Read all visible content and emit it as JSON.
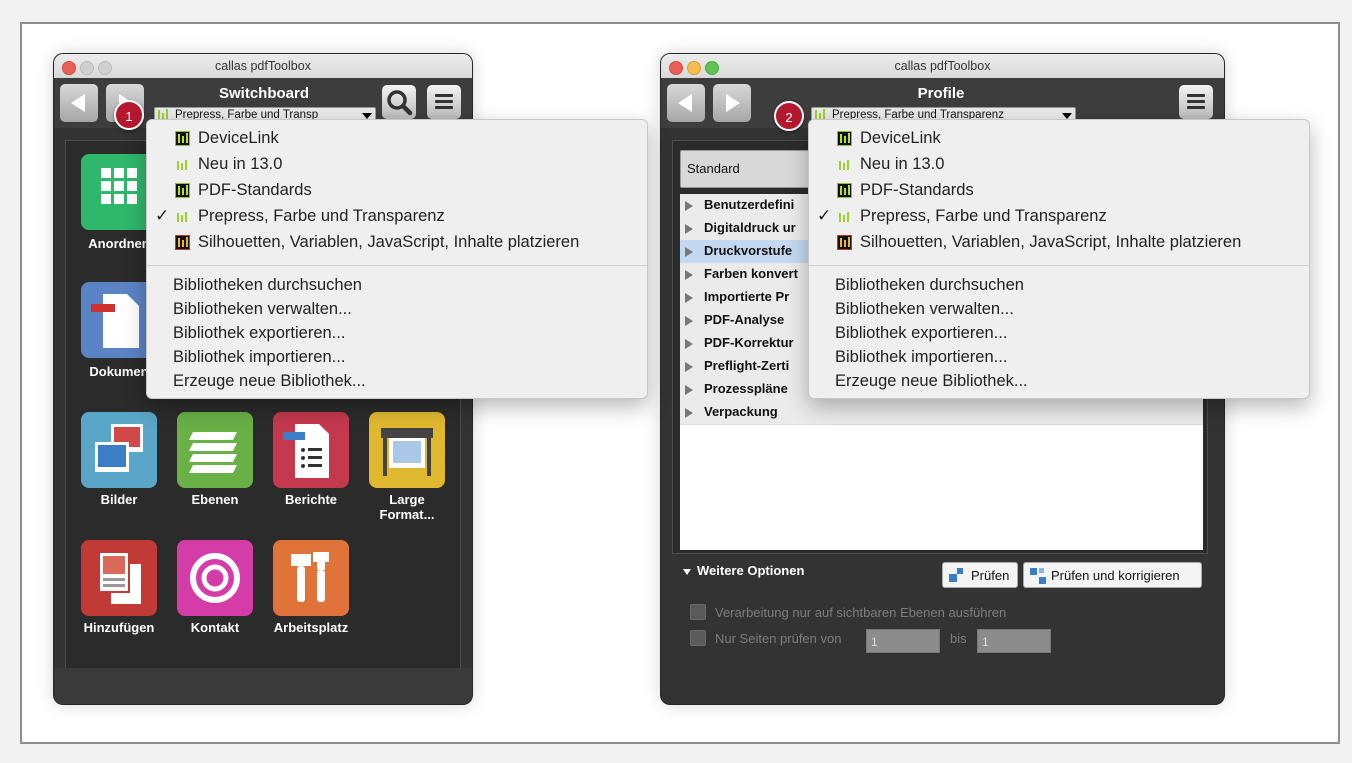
{
  "colors": {
    "badge": "#b5172f",
    "window_bg": "#333333",
    "highlight_row": "#c3d9f1"
  },
  "left_window": {
    "title": "callas pdfToolbox",
    "header_title": "Switchboard",
    "selector_value": "Prepress, Farbe und Transp",
    "badge": "1",
    "apps": [
      {
        "label": "Anordnen",
        "icon": "grid-icon"
      },
      {
        "label": "Dokumen",
        "icon": "document-icon"
      },
      {
        "label": "Bilder",
        "icon": "pictures-icon"
      },
      {
        "label": "Ebenen",
        "icon": "layers-icon"
      },
      {
        "label": "Berichte",
        "icon": "report-icon"
      },
      {
        "label": "Large Format...",
        "icon": "large-format-printer-icon"
      },
      {
        "label": "Hinzufügen",
        "icon": "add-pages-icon"
      },
      {
        "label": "Kontakt",
        "icon": "target-icon"
      },
      {
        "label": "Arbeitsplatz",
        "icon": "tools-icon"
      }
    ]
  },
  "right_window": {
    "title": "callas pdfToolbox",
    "header_title": "Profile",
    "selector_value": "Prepress, Farbe und Transparenz",
    "badge": "2",
    "dropdown_value": "Standard",
    "tree": [
      "Benutzerdefini",
      "Digitaldruck ur",
      "Druckvorstufe",
      "Farben konvert",
      "Importierte Pr",
      "PDF-Analyse",
      "PDF-Korrektur",
      "Preflight-Zerti",
      "Prozesspläne",
      "Verpackung"
    ],
    "more_options": "Weitere Optionen",
    "btn_check": "Prüfen",
    "btn_fix": "Prüfen und korrigieren",
    "opt_visible_layers": "Verarbeitung nur auf sichtbaren Ebenen ausführen",
    "opt_pages_prefix": "Nur Seiten prüfen von",
    "opt_pages_from": "1",
    "opt_pages_to_label": "bis",
    "opt_pages_to": "1"
  },
  "menu": {
    "libraries": [
      {
        "label": "DeviceLink",
        "checked": false
      },
      {
        "label": "Neu in 13.0",
        "checked": false
      },
      {
        "label": "PDF-Standards",
        "checked": false
      },
      {
        "label": "Prepress, Farbe und Transparenz",
        "checked": true
      },
      {
        "label": "Silhouetten, Variablen, JavaScript, Inhalte platzieren",
        "checked": false
      }
    ],
    "check_mark": "✓",
    "actions": [
      "Bibliotheken durchsuchen",
      "Bibliotheken verwalten...",
      "Bibliothek exportieren...",
      "Bibliothek importieren...",
      "Erzeuge neue Bibliothek..."
    ]
  }
}
